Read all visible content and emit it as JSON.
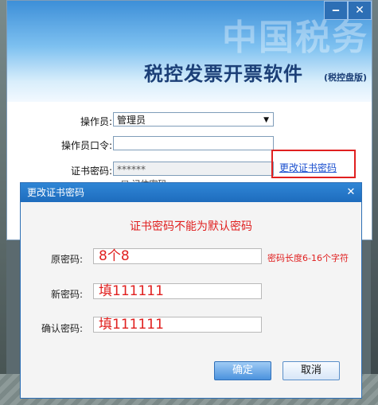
{
  "app": {
    "watermark": "中国税务",
    "title": "税控发票开票软件",
    "subtitle": "(税控盘版)",
    "minimize": "‒",
    "close": "✕"
  },
  "login": {
    "operator_label": "操作员:",
    "operator_value": "管理员",
    "password_label": "操作员口令:",
    "password_value": "",
    "cert_label": "证书密码:",
    "cert_value": "******",
    "change_cert_link": "更改证书密码",
    "partial_text": "☐ 记住密码"
  },
  "dialog": {
    "title": "更改证书密码",
    "close": "✕",
    "warning": "证书密码不能为默认密码",
    "old_label": "原密码:",
    "old_value": "8个8",
    "old_hint": "密码长度6-16个字符",
    "new_label": "新密码:",
    "new_value": "填111111",
    "confirm_label": "确认密码:",
    "confirm_value": "填111111",
    "ok_label": "确定",
    "cancel_label": "取消"
  },
  "colors": {
    "accent": "#1e6cbd",
    "warning": "#e02020",
    "link": "#1a4fcf"
  }
}
